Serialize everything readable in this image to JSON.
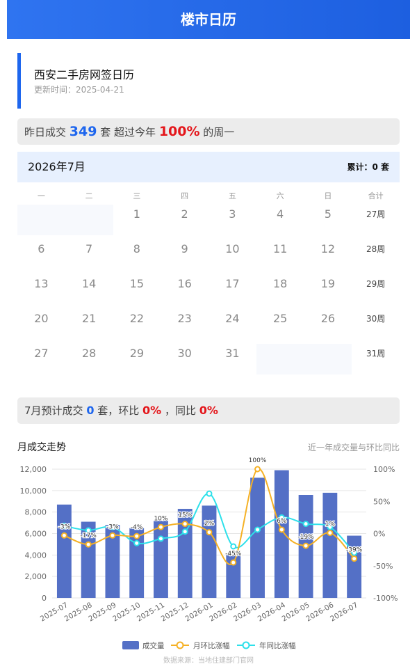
{
  "header": {
    "title": "楼市日历"
  },
  "info": {
    "name": "西安二手房网签日历",
    "updated": "更新时间：2025-04-21"
  },
  "yesterday": {
    "prefix": "昨日成交",
    "count": "349",
    "unit": "套 超过今年",
    "percent": "100%",
    "suffix": "的周一"
  },
  "calendar": {
    "month_label": "2026年7月",
    "total_label": "累计：0 套",
    "weekdays": [
      "一",
      "二",
      "三",
      "四",
      "五",
      "六",
      "日",
      "合计"
    ],
    "rows": [
      {
        "days": [
          "",
          "",
          "1",
          "2",
          "3",
          "4",
          "5"
        ],
        "week": "27周"
      },
      {
        "days": [
          "6",
          "7",
          "8",
          "9",
          "10",
          "11",
          "12"
        ],
        "week": "28周"
      },
      {
        "days": [
          "13",
          "14",
          "15",
          "16",
          "17",
          "18",
          "19"
        ],
        "week": "29周"
      },
      {
        "days": [
          "20",
          "21",
          "22",
          "23",
          "24",
          "25",
          "26"
        ],
        "week": "30周"
      },
      {
        "days": [
          "27",
          "28",
          "29",
          "30",
          "31",
          "",
          ""
        ],
        "week": "31周"
      }
    ]
  },
  "forecast": {
    "prefix": "7月预计成交",
    "count": "0",
    "unit": "套，环比",
    "mom": "0%",
    "sep": "，同比",
    "yoy": "0%"
  },
  "chart_section": {
    "title": "月成交走势",
    "subtitle": "近一年成交量与环比同比",
    "source": "数据来源：当地住建部门官网"
  },
  "chart_data": {
    "type": "bar",
    "categories": [
      "2025-07",
      "2025-08",
      "2025-09",
      "2025-10",
      "2025-11",
      "2025-12",
      "2026-01",
      "2026-02",
      "2026-03",
      "2026-04",
      "2026-05",
      "2026-06",
      "2026-07"
    ],
    "series": [
      {
        "name": "成交量",
        "type": "bar",
        "axis": "left",
        "color": "#5470c6",
        "values": [
          8700,
          7100,
          6800,
          6500,
          7200,
          8300,
          8600,
          4100,
          11200,
          11900,
          9600,
          9800,
          5800
        ]
      },
      {
        "name": "月环比涨幅",
        "type": "line",
        "axis": "right",
        "color": "#f5b125",
        "values": [
          -3,
          -17,
          -3,
          -4,
          10,
          15,
          2,
          -45,
          100,
          6,
          -19,
          1,
          -39
        ],
        "labels": [
          "-3%",
          "-17%",
          "-3%",
          "-4%",
          "10%",
          "15%",
          "2%",
          "-45%",
          "100%",
          "6%",
          "-19%",
          "1%",
          "-39%"
        ]
      },
      {
        "name": "年同比涨幅",
        "type": "line",
        "axis": "right",
        "color": "#2de0ea",
        "values": [
          12,
          5,
          10,
          -15,
          -8,
          3,
          62,
          -20,
          6,
          25,
          15,
          10,
          -30
        ]
      }
    ],
    "left_axis": {
      "min": 0,
      "max": 12000,
      "ticks": [
        "0",
        "2,000",
        "4,000",
        "6,000",
        "8,000",
        "10,000",
        "12,000"
      ]
    },
    "right_axis": {
      "min": -100,
      "max": 100,
      "ticks": [
        "-100%",
        "-50%",
        "0%",
        "50%",
        "100%"
      ]
    },
    "legend": "bottom-center"
  }
}
